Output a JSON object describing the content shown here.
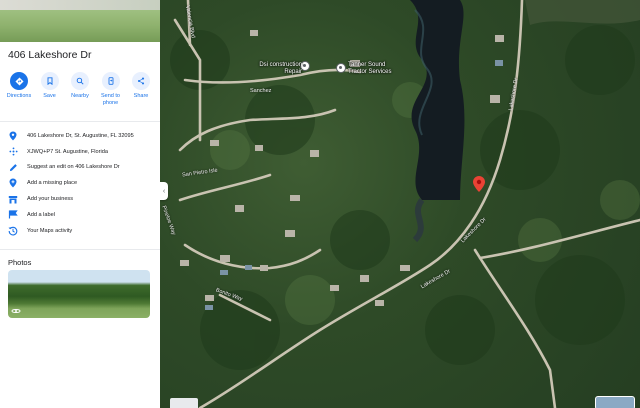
{
  "place": {
    "title": "406 Lakeshore Dr"
  },
  "actions": [
    {
      "label": "Directions",
      "icon": "directions-icon"
    },
    {
      "label": "Save",
      "icon": "bookmark-icon"
    },
    {
      "label": "Nearby",
      "icon": "nearby-icon"
    },
    {
      "label": "Send to phone",
      "icon": "send-to-phone-icon"
    },
    {
      "label": "Share",
      "icon": "share-icon"
    }
  ],
  "info": {
    "address": "406 Lakeshore Dr, St. Augustine, FL 32095",
    "plus_code": "XJWQ+P7 St. Augustine, Florida",
    "suggest_edit": "Suggest an edit on 406 Lakeshore Dr",
    "add_missing_place": "Add a missing place",
    "add_business": "Add your business",
    "add_label": "Add a label",
    "maps_activity": "Your Maps activity"
  },
  "photos": {
    "heading": "Photos"
  },
  "map": {
    "poi_1": "Dsi construction Repair",
    "poi_2": "Tanner Sound Tractor Services",
    "roads": {
      "r1": "Lakeshore Dr",
      "r2": "Lakeshore Dr",
      "r3": "Lakeshore Dr",
      "r4": "San Pietro Isle",
      "r5": "Pineloe Way",
      "r6": "Bonito Way",
      "r7": "Sanchez",
      "r8": "Valencia Blvd"
    },
    "pin_color": "#ea4335"
  },
  "colors": {
    "accent": "#1a73e8"
  }
}
